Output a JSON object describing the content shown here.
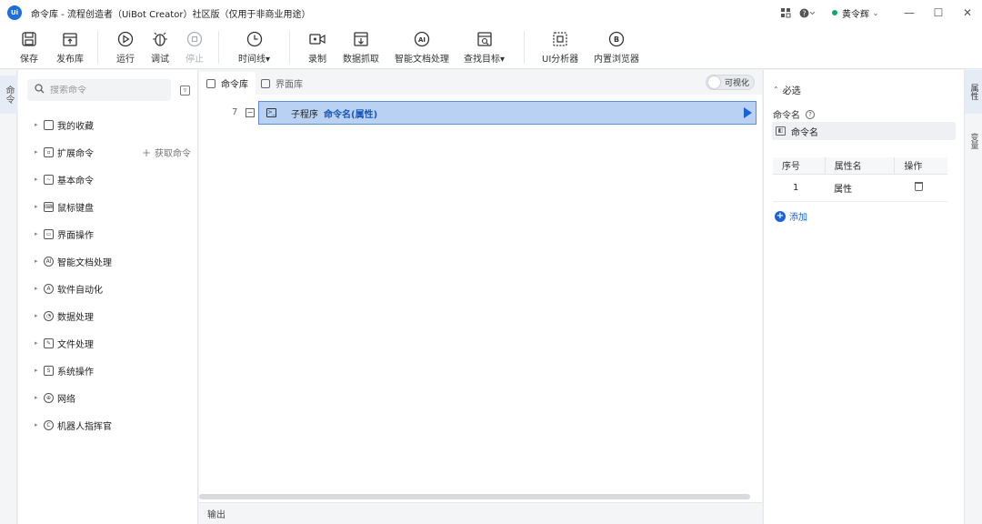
{
  "window": {
    "logo_text": "Ui",
    "title": "命令库 - 流程创造者（UiBot Creator）社区版（仅用于非商业用途）",
    "user_name": "黄令辉",
    "user_status_color": "#13a66b"
  },
  "toolbar": {
    "save": "保存",
    "publish": "发布库",
    "run": "运行",
    "debug": "调试",
    "stop": "停止",
    "timeline": "时间线",
    "record": "录制",
    "data_scrape": "数据抓取",
    "smart_doc": "智能文档处理",
    "find_target": "查找目标",
    "ui_analyzer": "UI分析器",
    "browser": "内置浏览器"
  },
  "left_strip": {
    "tab": "命令"
  },
  "command_panel": {
    "search_placeholder": "搜索命令",
    "items": [
      {
        "label": "我的收藏",
        "icon": "folder-icon"
      },
      {
        "label": "扩展命令",
        "icon": "extension-icon",
        "extra": "获取命令"
      },
      {
        "label": "基本命令",
        "icon": "basic-icon"
      },
      {
        "label": "鼠标键盘",
        "icon": "keyboard-icon"
      },
      {
        "label": "界面操作",
        "icon": "window-icon"
      },
      {
        "label": "智能文档处理",
        "icon": "ai-icon"
      },
      {
        "label": "软件自动化",
        "icon": "automation-icon"
      },
      {
        "label": "数据处理",
        "icon": "chart-icon"
      },
      {
        "label": "文件处理",
        "icon": "file-icon"
      },
      {
        "label": "系统操作",
        "icon": "system-icon"
      },
      {
        "label": "网络",
        "icon": "globe-icon"
      },
      {
        "label": "机器人指挥官",
        "icon": "commander-icon"
      }
    ]
  },
  "editor": {
    "tabs": [
      "命令库",
      "界面库"
    ],
    "toggle_label": "可视化",
    "line_number": "7",
    "block_keyword": "子程序",
    "block_signature": "命令名(属性)"
  },
  "output": {
    "label": "输出"
  },
  "properties": {
    "section": "必选",
    "field_label": "命令名",
    "field_value": "命令名",
    "table_headers": [
      "序号",
      "属性名",
      "操作"
    ],
    "rows": [
      {
        "index": "1",
        "name": "属性"
      }
    ],
    "add_label": "添加"
  },
  "right_strip": {
    "tabs": [
      "属性",
      "变量"
    ]
  },
  "colors": {
    "accent": "#1a63d6",
    "selection": "#b9d2f3"
  }
}
